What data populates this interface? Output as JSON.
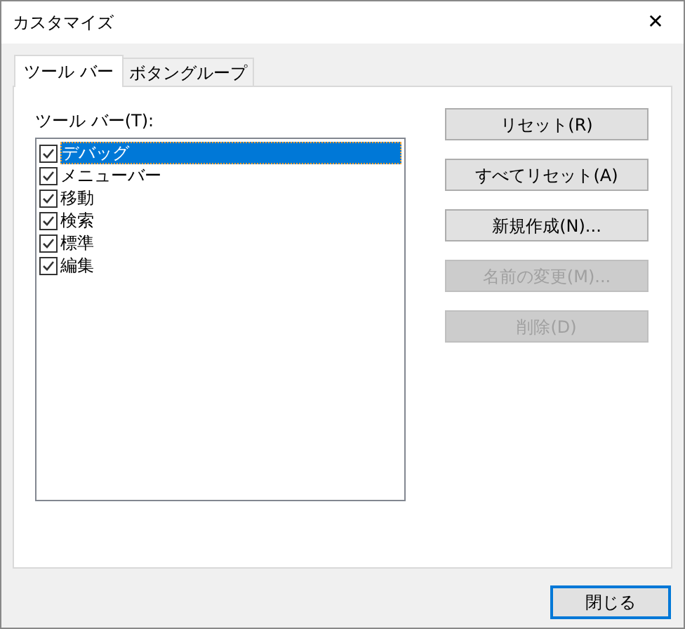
{
  "window": {
    "title": "カスタマイズ",
    "close_glyph": "✕"
  },
  "tabs": [
    {
      "label": "ツール バー",
      "selected": true
    },
    {
      "label": "ボタングループ",
      "selected": false
    }
  ],
  "toolbar_list": {
    "label": "ツール バー(T):",
    "items": [
      {
        "label": "デバッグ",
        "checked": true,
        "selected": true
      },
      {
        "label": "メニューバー",
        "checked": true,
        "selected": false
      },
      {
        "label": "移動",
        "checked": true,
        "selected": false
      },
      {
        "label": "検索",
        "checked": true,
        "selected": false
      },
      {
        "label": "標準",
        "checked": true,
        "selected": false
      },
      {
        "label": "編集",
        "checked": true,
        "selected": false
      }
    ]
  },
  "buttons": [
    {
      "label": "リセット(R)",
      "disabled": false
    },
    {
      "label": "すべてリセット(A)",
      "disabled": false
    },
    {
      "label": "新規作成(N)...",
      "disabled": false
    },
    {
      "label": "名前の変更(M)...",
      "disabled": true
    },
    {
      "label": "削除(D)",
      "disabled": true
    }
  ],
  "close_button": {
    "label": "閉じる"
  }
}
